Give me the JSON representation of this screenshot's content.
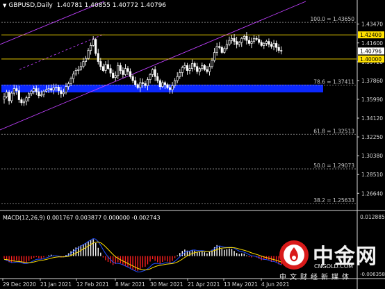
{
  "symbol_title": {
    "name": "GBPUSD,Daily",
    "values": "1.40781 1.40855 1.40772 1.40796"
  },
  "macd_title": {
    "name": "MACD(12,26,9)",
    "values": "0.001767 0.003877 0.000000 -0.002743"
  },
  "watermark": {
    "brand": "中金网",
    "domain": "CNGOLD.COM",
    "subtitle": "中文财经新媒体"
  },
  "colors": {
    "background": "#000000",
    "axis": "#d8d8d8",
    "candle": "#ffffff",
    "grid": "#9c9c9c",
    "channel": "#c040ff",
    "fib_text": "#c8c8c8",
    "highlight_line": "#ffe000",
    "price_label_bg": "#ffe000",
    "blue_zone": "#0b28ff",
    "macd_hist_up": "#ffffff",
    "macd_hist_down": "#ff1f1f",
    "macd_signal": "#ffe000",
    "macd_line": "#1f4dff",
    "brand_red": "#d91a1a"
  },
  "chart_data": {
    "type": "candlestick",
    "timeframe": "Daily",
    "ylim": [
      1.25,
      1.449
    ],
    "current": {
      "open": 1.40781,
      "high": 1.40855,
      "low": 1.40772,
      "close": 1.40796
    },
    "price_ticks": [
      "1.43470",
      "1.41600",
      "1.39720",
      "1.37860",
      "1.35990",
      "1.34120",
      "1.32250",
      "1.30380",
      "1.28510",
      "1.26640"
    ],
    "price_tick_values": [
      1.4347,
      1.416,
      1.3972,
      1.3786,
      1.3599,
      1.3412,
      1.3225,
      1.3038,
      1.2851,
      1.2664
    ],
    "highlight_labels": [
      {
        "text": "1.42400",
        "value": 1.424
      },
      {
        "text": "1.40796",
        "value": 1.40796
      },
      {
        "text": "1.40000",
        "value": 1.4
      }
    ],
    "fibonacci": [
      {
        "text": "100.0 = 1.43650",
        "value": 1.4365
      },
      {
        "text": "78.6 = 1.37411",
        "value": 1.37411
      },
      {
        "text": "61.8 = 1.32513",
        "value": 1.32513
      },
      {
        "text": "50.0 = 1.29073",
        "value": 1.29073
      },
      {
        "text": "38.2 = 1.25633",
        "value": 1.25633
      }
    ],
    "blue_zone": [
      1.3668,
      1.3745
    ],
    "date_labels": [
      "29 Dec 2020",
      "21 Jan 2021",
      "12 Feb 2021",
      "8 Mar 2021",
      "30 Mar 2021",
      "21 Apr 2021",
      "13 May 2021",
      "4 Jun 2021"
    ],
    "closes": [
      1.3625,
      1.367,
      1.3585,
      1.366,
      1.3705,
      1.3685,
      1.3595,
      1.3565,
      1.358,
      1.3615,
      1.3655,
      1.368,
      1.3705,
      1.3675,
      1.3635,
      1.3645,
      1.368,
      1.3695,
      1.3705,
      1.369,
      1.3715,
      1.372,
      1.3685,
      1.3655,
      1.367,
      1.3725,
      1.3755,
      1.3805,
      1.385,
      1.3885,
      1.3895,
      1.3925,
      1.3975,
      1.4005,
      1.4085,
      1.4135,
      1.4195,
      1.4055,
      1.3975,
      1.3925,
      1.3885,
      1.3945,
      1.3905,
      1.386,
      1.3815,
      1.3835,
      1.3935,
      1.3885,
      1.3845,
      1.3905,
      1.3875,
      1.3825,
      1.3785,
      1.3745,
      1.3715,
      1.3765,
      1.3755,
      1.3735,
      1.3795,
      1.3845,
      1.3895,
      1.3825,
      1.3785,
      1.3725,
      1.3765,
      1.3745,
      1.3715,
      1.3695,
      1.3735,
      1.3785,
      1.3825,
      1.3865,
      1.3915,
      1.3935,
      1.3885,
      1.3905,
      1.3955,
      1.3925,
      1.3875,
      1.3905,
      1.3935,
      1.3895,
      1.3875,
      1.3925,
      1.3985,
      1.4065,
      1.4125,
      1.4115,
      1.4065,
      1.4105,
      1.4145,
      1.4185,
      1.4205,
      1.4175,
      1.4145,
      1.4165,
      1.4205,
      1.4225,
      1.4185,
      1.4155,
      1.4175,
      1.4205,
      1.4195,
      1.4165,
      1.4135,
      1.4155,
      1.4175,
      1.4145,
      1.4125,
      1.4155,
      1.4115,
      1.4085,
      1.408
    ],
    "macd_title": "MACD(12,26,9)",
    "macd_ylim": [
      -0.006358,
      0.012885
    ],
    "macd_ticks": [
      "0.012885",
      "-0.006358"
    ],
    "macd_hist": [
      -0.0008,
      -0.0014,
      -0.0018,
      -0.002,
      -0.0016,
      -0.0012,
      -0.0015,
      -0.0019,
      -0.0022,
      -0.0018,
      -0.0014,
      -0.0009,
      -0.0005,
      -0.0003,
      -0.0006,
      -0.0008,
      -0.0004,
      -0.0001,
      0.0002,
      0.0004,
      0.0002,
      0.0001,
      -0.0002,
      -0.0004,
      -0.0003,
      0.0003,
      0.0008,
      0.0014,
      0.002,
      0.0025,
      0.0028,
      0.0031,
      0.0035,
      0.0038,
      0.0043,
      0.0046,
      0.0049,
      0.0038,
      0.0024,
      0.001,
      -0.0004,
      -0.0012,
      -0.0017,
      -0.0021,
      -0.0026,
      -0.0023,
      -0.0018,
      -0.0021,
      -0.0026,
      -0.0029,
      -0.0032,
      -0.0036,
      -0.0039,
      -0.0042,
      -0.0043,
      -0.0038,
      -0.0033,
      -0.0031,
      -0.0024,
      -0.0016,
      -0.0009,
      -0.0014,
      -0.0018,
      -0.0022,
      -0.0017,
      -0.0013,
      -0.0016,
      -0.0019,
      -0.0014,
      -0.0006,
      0.0002,
      0.0009,
      0.0015,
      0.0019,
      0.0016,
      0.0014,
      0.0018,
      0.0016,
      0.0011,
      0.0012,
      0.0014,
      0.0011,
      0.0008,
      0.0012,
      0.0018,
      0.0026,
      0.0032,
      0.0028,
      0.0021,
      0.0018,
      0.002,
      0.0022,
      0.0021,
      0.0015,
      0.0009,
      0.0006,
      0.0008,
      0.0007,
      0.0002,
      -0.0003,
      -0.0004,
      -0.0001,
      -0.0004,
      -0.0008,
      -0.0012,
      -0.0011,
      -0.0009,
      -0.0013,
      -0.0017,
      -0.0014,
      -0.0019,
      -0.0024,
      -0.0026
    ]
  }
}
